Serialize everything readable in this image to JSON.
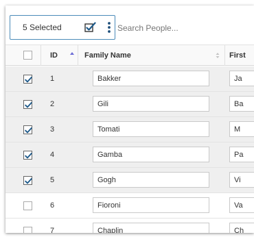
{
  "toolbar": {
    "selected_label": "5 Selected",
    "search_placeholder": "Search People..."
  },
  "columns": {
    "id": "ID",
    "family_name": "Family Name",
    "first_name": "First"
  },
  "rows": [
    {
      "id": "1",
      "family_name": "Bakker",
      "first_name": "Ja",
      "selected": true
    },
    {
      "id": "2",
      "family_name": "Gili",
      "first_name": "Ba",
      "selected": true
    },
    {
      "id": "3",
      "family_name": "Tomati",
      "first_name": "M",
      "selected": true
    },
    {
      "id": "4",
      "family_name": "Gamba",
      "first_name": "Pa",
      "selected": true
    },
    {
      "id": "5",
      "family_name": "Gogh",
      "first_name": "Vi",
      "selected": true
    },
    {
      "id": "6",
      "family_name": "Fioroni",
      "first_name": "Va",
      "selected": false
    },
    {
      "id": "7",
      "family_name": "Chaplin",
      "first_name": "Ch",
      "selected": false
    }
  ],
  "colors": {
    "accent": "#4a8ab8",
    "checkbox_mark": "#1e5a8a",
    "sort_active": "#6b6bd6",
    "selected_row_bg": "#efefef"
  },
  "icons": {
    "select_all": "checkbox-check-icon",
    "menu": "kebab-menu-icon",
    "sort_asc": "sort-ascending-icon",
    "sort_none": "sort-both-icon"
  }
}
